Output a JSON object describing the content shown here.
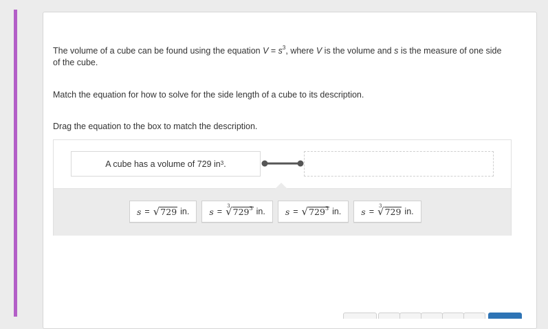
{
  "question": {
    "intro_before_formula": "The volume of a cube can be found using the equation ",
    "formula_V": "V",
    "formula_eq": " = ",
    "formula_s": "s",
    "formula_exp": "3",
    "intro_mid": ", where ",
    "intro_V": "V",
    "intro_mid2": " is the volume and ",
    "intro_s": "s",
    "intro_after": " is the measure of one side of the cube.",
    "instruction": "Match the equation for how to solve for the side length of a cube to its description.",
    "drag_hint": "Drag the equation to the box to match the description."
  },
  "match": {
    "description": "A cube has a volume of 729 in",
    "description_exp": "3",
    "description_end": ".",
    "drop_target_value": ""
  },
  "tiles": [
    {
      "lhs": "s",
      "eq": "=",
      "index": "",
      "radicand": "729",
      "radicand_exp": "",
      "unit": "in."
    },
    {
      "lhs": "s",
      "eq": "=",
      "index": "3",
      "radicand": "729",
      "radicand_exp": "3",
      "unit": "in."
    },
    {
      "lhs": "s",
      "eq": "=",
      "index": "",
      "radicand": "729",
      "radicand_exp": "3",
      "unit": "in."
    },
    {
      "lhs": "s",
      "eq": "=",
      "index": "3",
      "radicand": "729",
      "radicand_exp": "",
      "unit": "in."
    }
  ],
  "colors": {
    "accent": "#b35fc7",
    "connector": "#555555",
    "next_button": "#2e74b5"
  }
}
